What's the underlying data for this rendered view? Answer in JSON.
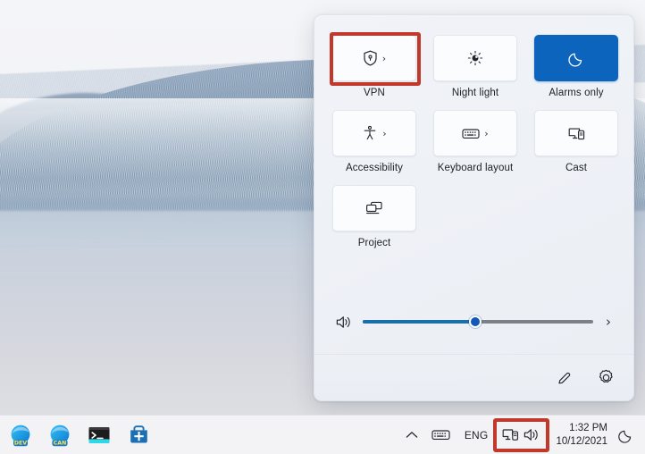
{
  "desktop": {
    "wallpaper_name": "windows-11-flow-wallpaper",
    "accent_color": "#0c64bd"
  },
  "quick_settings": {
    "panel_name": "Quick Settings",
    "highlight_color": "#c0392b",
    "tiles": [
      {
        "id": "vpn",
        "label": "VPN",
        "icon": "shield-vpn-icon",
        "has_chevron": true,
        "active": false,
        "highlighted": true
      },
      {
        "id": "night-light",
        "label": "Night light",
        "icon": "night-light-icon",
        "has_chevron": false,
        "active": false,
        "highlighted": false
      },
      {
        "id": "alarms-only",
        "label": "Alarms only",
        "icon": "moon-icon",
        "has_chevron": false,
        "active": true,
        "highlighted": false
      },
      {
        "id": "accessibility",
        "label": "Accessibility",
        "icon": "accessibility-icon",
        "has_chevron": true,
        "active": false,
        "highlighted": false
      },
      {
        "id": "keyboard-layout",
        "label": "Keyboard layout",
        "icon": "keyboard-icon",
        "has_chevron": true,
        "active": false,
        "highlighted": false
      },
      {
        "id": "cast",
        "label": "Cast",
        "icon": "cast-icon",
        "has_chevron": false,
        "active": false,
        "highlighted": false
      },
      {
        "id": "project",
        "label": "Project",
        "icon": "project-icon",
        "has_chevron": false,
        "active": false,
        "highlighted": false
      }
    ],
    "volume": {
      "icon": "speaker-icon",
      "value_percent": 49,
      "expand_icon": "chevron-right-icon"
    },
    "footer": {
      "edit_icon": "pencil-edit-icon",
      "settings_icon": "gear-settings-icon"
    }
  },
  "taskbar": {
    "apps": [
      {
        "id": "edge-dev",
        "name": "Microsoft Edge Dev",
        "badge": "DEV"
      },
      {
        "id": "edge-canary",
        "name": "Microsoft Edge Canary",
        "badge": "CAN"
      },
      {
        "id": "windows-terminal",
        "name": "Windows Terminal",
        "badge": ""
      },
      {
        "id": "microsoft-store",
        "name": "Microsoft Store",
        "badge": ""
      }
    ],
    "tray": {
      "overflow_icon": "chevron-up-icon",
      "keyboard_icon": "touch-keyboard-icon",
      "language": "ENG",
      "network_icon": "network-ethernet-icon",
      "volume_icon": "speaker-icon",
      "highlighted_group": true
    },
    "clock": {
      "time": "1:32 PM",
      "date": "10/12/2021"
    },
    "notifications_icon": "moon-crescent-icon"
  }
}
